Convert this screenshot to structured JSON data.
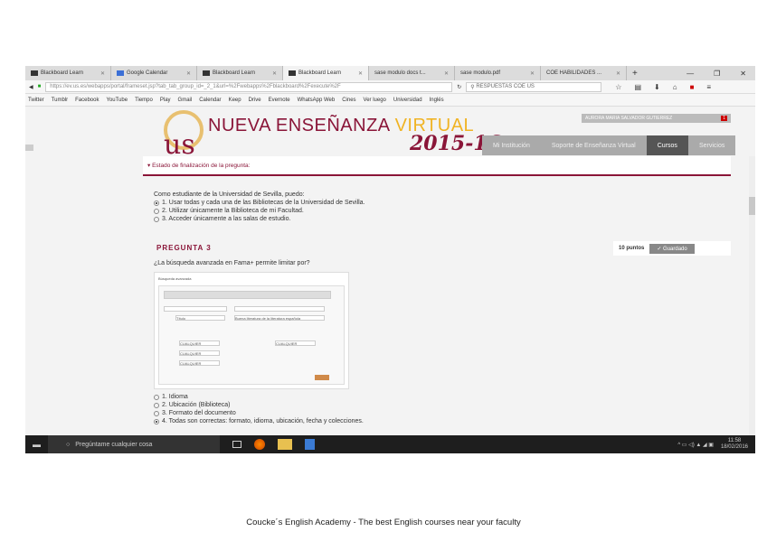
{
  "browser": {
    "tabs": [
      "Blackboard Learn",
      "Google Calendar",
      "Blackboard Learn",
      "Blackboard Learn",
      "sase modulo docs t...",
      "sase modulo.pdf",
      "COE  HABILIDADES ..."
    ],
    "url": "https://ev.us.es/webapps/portal/frameset.jsp?tab_tab_group_id=_2_1&url=%2Fwebapps%2Fblackboard%2Fexecute%2F",
    "search": "RESPUESTAS COE US",
    "bookmarks": [
      "Twitter",
      "Tumblr",
      "Facebook",
      "YouTube",
      "Tiempo",
      "Play",
      "Gmail",
      "Calendar",
      "Keep",
      "Drive",
      "Evernote",
      "WhatsApp Web",
      "Cines",
      "Ver luego",
      "Universidad",
      "Inglés"
    ]
  },
  "header": {
    "brand_a": "NUEVA ENSEÑANZA ",
    "brand_b": "VIRTUAL",
    "year": "2015-16",
    "user": "AURORA MARIA SALVADOR GUTIERREZ",
    "notif": "1",
    "nav": [
      "Mi Institución",
      "Soporte de Enseñanza Virtual",
      "Cursos",
      "Servicios"
    ]
  },
  "content": {
    "status": "▾ Estado de finalización de la pregunta:",
    "q2_text": "Como estudiante de la Universidad de Sevilla, puedo:",
    "q2_options": [
      "1. Usar todas y cada una de las Bibliotecas de la Universidad de Sevilla.",
      "2. Utilizar únicamente la Biblioteca de mi Facultad.",
      "3. Acceder únicamente a las salas de estudio."
    ],
    "q3_title": "PREGUNTA 3",
    "points": "10 puntos",
    "saved": "✓ Guardado",
    "q3_text": "¿La búsqueda avanzada en Fama+ permite limitar por?",
    "img_title": "Búsqueda avanzada",
    "img_fields": [
      "Título",
      "Buena literatura de la literatura española",
      "CUALQUIER",
      "CUALQUIER",
      "CUALQUIER",
      "CUALQUIER"
    ],
    "q3_options": [
      "1. Idioma",
      "2. Ubicación (Biblioteca)",
      "3. Formato del documento",
      "4. Todas son correctas: formato, idioma, ubicación, fecha y colecciones."
    ]
  },
  "taskbar": {
    "search": "Pregúntame cualquier cosa",
    "time": "11:58",
    "date": "18/02/2016"
  },
  "footer": "Coucke´s English Academy - The best English courses near your faculty"
}
